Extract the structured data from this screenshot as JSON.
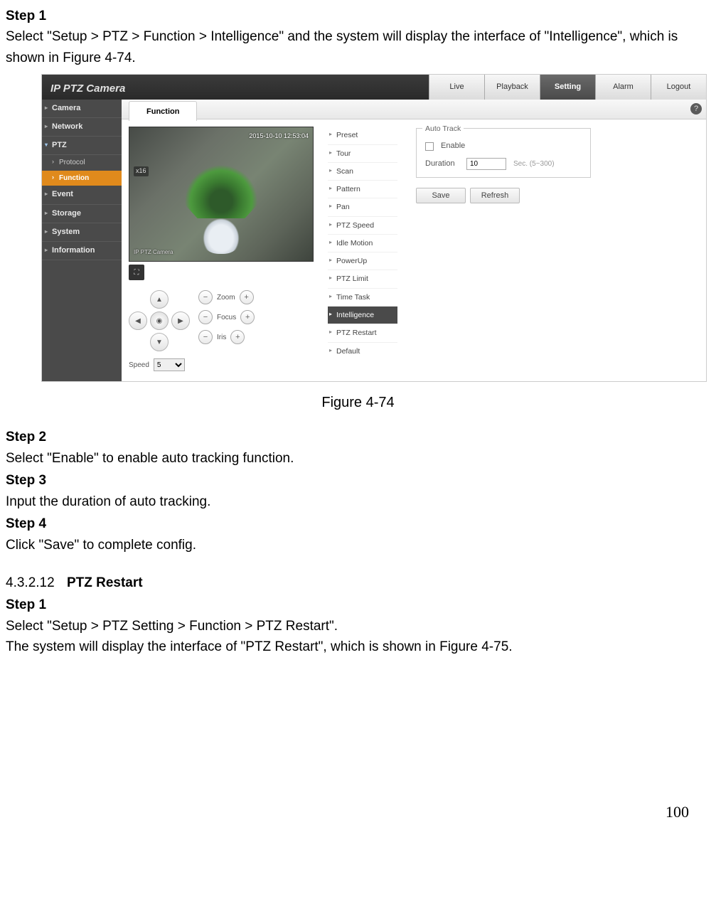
{
  "doc": {
    "step1_head": "Step 1",
    "step1_body": "Select \"Setup > PTZ > Function > Intelligence\" and the system will display the interface of \"Intelligence\", which is shown in Figure 4-74.",
    "figure_caption": "Figure 4-74",
    "step2_head": "Step 2",
    "step2_body": "Select \"Enable\" to enable auto tracking function.",
    "step3_head": "Step 3",
    "step3_body": "Input the duration of auto tracking.",
    "step4_head": "Step 4",
    "step4_body": "Click \"Save\" to complete config.",
    "section_num": "4.3.2.12",
    "section_title": "PTZ Restart",
    "r_step1_head": "Step 1",
    "r_step1_l1": "Select \"Setup > PTZ Setting > Function > PTZ Restart\".",
    "r_step1_l2": "The system will display the interface of \"PTZ Restart\", which is shown in Figure 4-75.",
    "page_number": "100"
  },
  "shot": {
    "brand": "IP PTZ Camera",
    "topnav": {
      "live": "Live",
      "playback": "Playback",
      "setting": "Setting",
      "alarm": "Alarm",
      "logout": "Logout"
    },
    "sidenav": {
      "camera": "Camera",
      "network": "Network",
      "ptz": "PTZ",
      "protocol": "Protocol",
      "function": "Function",
      "event": "Event",
      "storage": "Storage",
      "system": "System",
      "information": "Information"
    },
    "tab": "Function",
    "help_tooltip": "?",
    "preview": {
      "timestamp": "2015-10-10 12:53:04",
      "zoom": "x16",
      "watermark": "IP PTZ Camera"
    },
    "ptz": {
      "zoom": "Zoom",
      "focus": "Focus",
      "iris": "Iris",
      "speed_label": "Speed",
      "speed_value": "5"
    },
    "funcs": {
      "preset": "Preset",
      "tour": "Tour",
      "scan": "Scan",
      "pattern": "Pattern",
      "pan": "Pan",
      "ptz_speed": "PTZ Speed",
      "idle": "Idle Motion",
      "powerup": "PowerUp",
      "ptz_limit": "PTZ Limit",
      "time_task": "Time Task",
      "intelligence": "Intelligence",
      "ptz_restart": "PTZ Restart",
      "default": "Default"
    },
    "panel": {
      "legend": "Auto Track",
      "enable": "Enable",
      "duration": "Duration",
      "duration_value": "10",
      "duration_hint": "Sec. (5~300)",
      "save": "Save",
      "refresh": "Refresh"
    }
  }
}
